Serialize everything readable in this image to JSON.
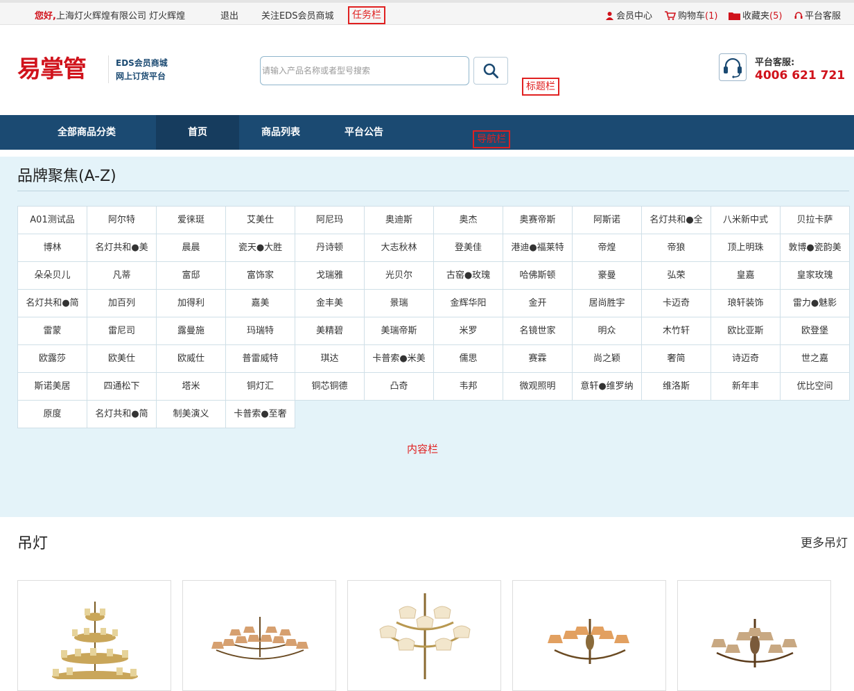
{
  "topbar": {
    "greet_hi": "您好,",
    "greet_user": "上海灯火辉煌有限公司 灯火辉煌",
    "logout": "退出",
    "follow": "关注EDS会员商城",
    "annotation": "任务栏",
    "member_center": "会员中心",
    "cart_label": "购物车",
    "cart_count": "(1)",
    "favorites_label": "收藏夹",
    "favorites_count": "(5)",
    "service": "平台客服",
    "accent_color": "#d0121b"
  },
  "header": {
    "logo_text": "易掌管",
    "logo_sub1": "EDS会员商城",
    "logo_sub2": "网上订货平台",
    "search_placeholder": "请输入产品名称或者型号搜索",
    "annotation": "标题栏",
    "hotline_label": "平台客服:",
    "hotline_number": "4006 621 721"
  },
  "nav": {
    "items": [
      "全部商品分类",
      "首页",
      "商品列表",
      "平台公告"
    ],
    "active_index": 1,
    "annotation": "导航栏",
    "bg_color": "#1b4a72"
  },
  "brands": {
    "title": "品牌聚焦(A-Z)",
    "items": [
      "A01测试品",
      "阿尔特",
      "爱徕珽",
      "艾美仕",
      "阿尼玛",
      "奥迪斯",
      "奥杰",
      "奥赛帝斯",
      "阿斯诺",
      "名灯共和●全",
      "八米新中式",
      "贝拉卡萨",
      "博林",
      "名灯共和●美",
      "晨晨",
      "瓷天●大胜",
      "丹诗顿",
      "大志秋林",
      "登美佳",
      "港迪●福莱特",
      "帝煌",
      "帝狼",
      "顶上明珠",
      "敦博●瓷韵美",
      "朵朵贝儿",
      "凡蒂",
      "富邸",
      "富饰家",
      "戈瑞雅",
      "光贝尔",
      "古窑●玫瑰",
      "哈佛斯顿",
      "豪曼",
      "弘荣",
      "皇嘉",
      "皇家玫瑰",
      "名灯共和●简",
      "加百列",
      "加得利",
      "嘉美",
      "金丰美",
      "景瑞",
      "金辉华阳",
      "金开",
      "居尚胜宇",
      "卡迈奇",
      "琅轩装饰",
      "雷力●魅影",
      "雷蒙",
      "雷尼司",
      "露曼施",
      "玛瑞特",
      "美精碧",
      "美瑞帝斯",
      "米罗",
      "名镜世家",
      "明众",
      "木竹轩",
      "欧比亚斯",
      "欧登堡",
      "欧露莎",
      "欧美仕",
      "欧威仕",
      "普雷威特",
      "琪达",
      "卡普索●米美",
      "儒思",
      "赛霖",
      "尚之颖",
      "奢简",
      "诗迈奇",
      "世之嘉",
      "斯诺美居",
      "四通松下",
      "塔米",
      "铜灯汇",
      "铜芯铜德",
      "凸奇",
      "韦邦",
      "微观照明",
      "意轩●维罗纳",
      "维洛斯",
      "新年丰",
      "优比空间",
      "原度",
      "名灯共和●简",
      "制美演义",
      "卡普索●至奢"
    ],
    "content_annotation": "内容栏",
    "bg_color": "#e4f3f9"
  },
  "pendant": {
    "title": "吊灯",
    "more": "更多吊灯",
    "products": [
      "tiered-chandelier",
      "wide-chandelier",
      "glass-shade-chandelier",
      "bronze-chandelier",
      "classic-chandelier"
    ]
  }
}
